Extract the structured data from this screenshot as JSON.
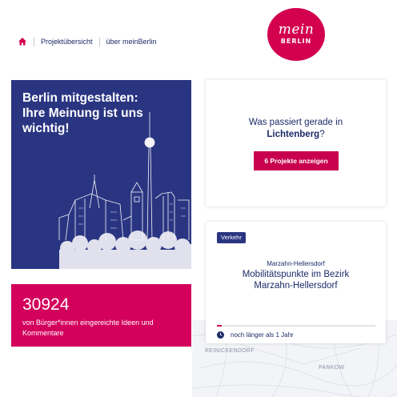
{
  "nav": {
    "home_icon": "home-icon",
    "items": [
      {
        "label": "Projektübersicht"
      },
      {
        "label": "über meinBerlin"
      }
    ]
  },
  "logo": {
    "script": "mein",
    "word": "BERLIN",
    "color": "#d3004f"
  },
  "hero": {
    "title": "Berlin mitgestalten: Ihre Meinung ist uns wichtig!",
    "background": "#2a3582"
  },
  "stats": {
    "count": "30924",
    "text": "von Bürger*innen eingereichte Ideen und Kommentare",
    "background": "#d3005c"
  },
  "district_card": {
    "question_prefix": "Was passiert gerade in",
    "district": "Lichtenberg",
    "question_suffix": "?",
    "button_label": "6 Projekte anzeigen"
  },
  "project_card": {
    "tag": "Verkehr",
    "district": "Marzahn-Hellersdorf",
    "title": "Mobilitätspunkte im Bezirk Marzahn-Hellersdorf",
    "progress": 0.03,
    "time_label": "noch länger als 1 Jahr",
    "clock_icon": "clock-icon"
  },
  "map": {
    "labels": [
      "REINICKENDORF",
      "PANKOW"
    ]
  }
}
